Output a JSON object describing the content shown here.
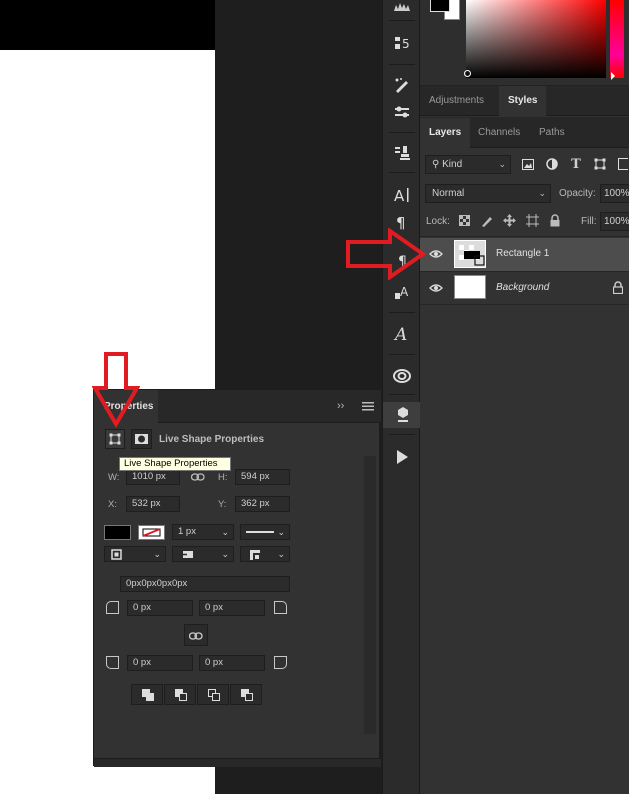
{
  "colors": {
    "accent_arrow": "#e01b22",
    "canvas": "#ffffff",
    "panel": "#323232",
    "tooltip_bg": "#ffffe1"
  },
  "panel_tabs_top": [
    {
      "label": "Adjustments",
      "active": false
    },
    {
      "label": "Styles",
      "active": true
    }
  ],
  "panel_tabs_layers": [
    {
      "label": "Layers",
      "active": true
    },
    {
      "label": "Channels",
      "active": false
    },
    {
      "label": "Paths",
      "active": false
    }
  ],
  "layers_panel": {
    "filter_kind": "Kind",
    "blend_mode": "Normal",
    "opacity_label": "Opacity:",
    "opacity_value": "100%",
    "lock_label": "Lock:",
    "fill_label": "Fill:",
    "fill_value": "100%",
    "layers": [
      {
        "name": "Rectangle 1",
        "selected": true
      },
      {
        "name": "Background",
        "selected": false,
        "locked": true
      }
    ]
  },
  "properties": {
    "tab": "Properties",
    "section_title": "Live Shape Properties",
    "tooltip": "Live Shape Properties",
    "w_label": "W:",
    "w_value": "1010 px",
    "h_label": "H:",
    "h_value": "594 px",
    "x_label": "X:",
    "x_value": "532 px",
    "y_label": "Y:",
    "y_value": "362 px",
    "stroke_width": "1 px",
    "corner_radii_text": "0px0px0px0px",
    "corners": [
      "0 px",
      "0 px",
      "0 px",
      "0 px"
    ]
  },
  "tools": [
    "histogram-icon",
    "properties-swap-icon",
    "brush-settings-icon",
    "brush-presets-icon",
    "clone-source-icon",
    "character-icon",
    "paragraph-icon",
    "paragraph-styles-icon",
    "character-styles-icon",
    "glyphs-icon",
    "creative-cloud-icon",
    "3d-icon",
    "play-icon"
  ]
}
